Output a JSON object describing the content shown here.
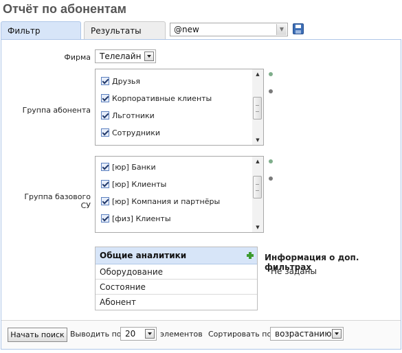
{
  "page": {
    "title": "Отчёт по абонентам"
  },
  "tabs": [
    {
      "label": "Фильтр",
      "active": true
    },
    {
      "label": "Результаты",
      "active": false
    }
  ],
  "preset": {
    "value": "@new",
    "save_icon": "floppy-disk-icon"
  },
  "filters": {
    "firm": {
      "label": "Фирма",
      "value": "Телелайн"
    },
    "subscriber_group": {
      "label": "Группа абонента",
      "items": [
        {
          "label": "Друзья",
          "checked": true
        },
        {
          "label": "Корпоративные клиенты",
          "checked": true
        },
        {
          "label": "Льготники",
          "checked": true
        },
        {
          "label": "Сотрудники",
          "checked": true
        }
      ]
    },
    "base_group": {
      "label": "Группа базового СУ",
      "items": [
        {
          "label": "[юр] Банки",
          "checked": true
        },
        {
          "label": "[юр] Клиенты",
          "checked": true
        },
        {
          "label": "[юр] Компания и партнёры",
          "checked": true
        },
        {
          "label": "[физ] Клиенты",
          "checked": true
        }
      ]
    },
    "status_colors": {
      "select_all": "#7fae8b",
      "clear_all": "#7a7a7a"
    }
  },
  "analytics": {
    "header": "Общие аналитики",
    "add_icon": "plus-icon",
    "items": [
      "Оборудование",
      "Состояние",
      "Абонент"
    ]
  },
  "extra_filters": {
    "title": "Информация о доп. фильтрах",
    "value": "Не заданы"
  },
  "bottom": {
    "search_button": "Начать поиск",
    "show_label": "Выводить по",
    "page_size": "20",
    "elements_label": "элементов",
    "sort_label": "Сортировать по",
    "sort_value": "возрастанию"
  }
}
